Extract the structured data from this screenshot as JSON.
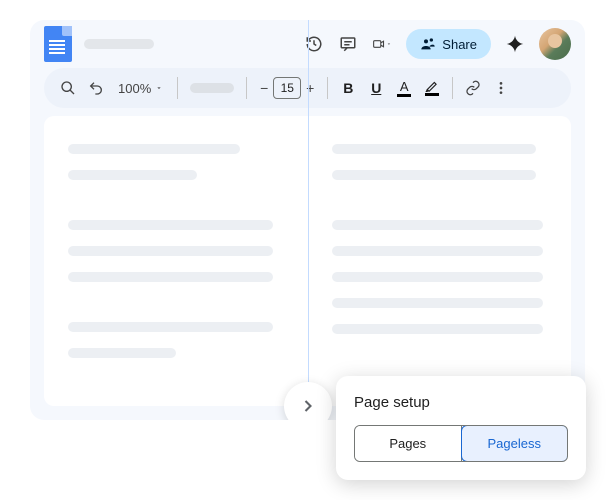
{
  "header": {
    "share_label": "Share"
  },
  "toolbar": {
    "zoom": "100%",
    "font_size": "15",
    "minus": "−",
    "plus": "+",
    "bold": "B",
    "underline": "U",
    "text_color_letter": "A"
  },
  "popup": {
    "title": "Page setup",
    "options": [
      "Pages",
      "Pageless"
    ],
    "active_index": 1
  }
}
